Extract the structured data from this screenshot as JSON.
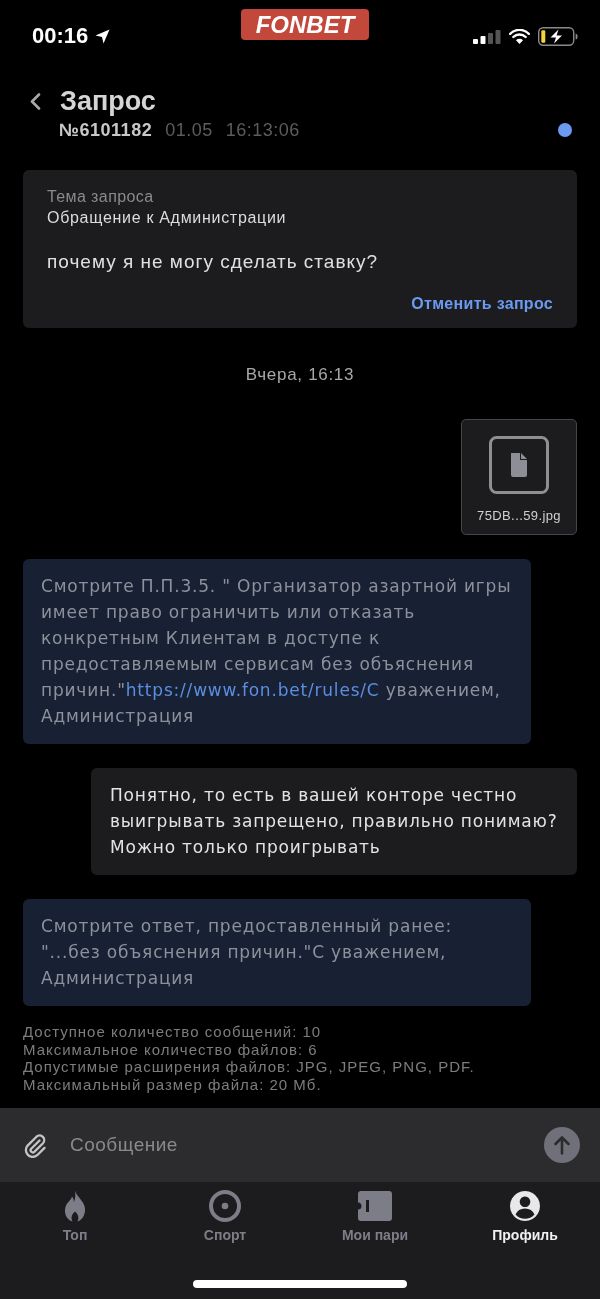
{
  "status_bar": {
    "time": "00:16",
    "logo": "FONBET"
  },
  "header": {
    "title": "Запрос",
    "request_number": "№6101182",
    "date": "01.05",
    "time": "16:13:06"
  },
  "request": {
    "topic_label": "Тема запроса",
    "topic": "Обращение к Администрации",
    "question": "почему я не могу сделать ставку?",
    "cancel_action": "Отменить запрос"
  },
  "messages": [
    {
      "kind": "date",
      "text": "Вчера, 16:13"
    },
    {
      "kind": "file",
      "outgoing": true,
      "file_name": "75DB...59.jpg"
    },
    {
      "kind": "text",
      "outgoing": false,
      "text": "Смотрите П.П.3.5. \" Организатор азартной игры имеет право ограничить или отказать конкретным Клиентам в доступе к предоставляемым сервисам без объяснения причин.\"",
      "link": "https://www.fon.bet/rules/С",
      "text_after": "уважением, Администрация"
    },
    {
      "kind": "text",
      "outgoing": true,
      "text": "Понятно, то есть в вашей конторе честно выигрывать запрещено, правильно понимаю? Можно только проигрывать"
    },
    {
      "kind": "text",
      "outgoing": false,
      "text": "Смотрите ответ, предоставленный ранее: \"...без объяснения причин.\"С уважением, Администрация"
    }
  ],
  "limits": [
    "Доступное количество сообщений: 10",
    "Максимальное количество файлов: 6",
    "Допустимые расширения файлов: JPG, JPEG, PNG, PDF.",
    "Максимальный размер файла: 20 Мб."
  ],
  "composer": {
    "placeholder": "Сообщение"
  },
  "tabs": [
    {
      "label": "Топ",
      "selected": false
    },
    {
      "label": "Спорт",
      "selected": false
    },
    {
      "label": "Мои пари",
      "selected": false
    },
    {
      "label": "Профиль",
      "selected": true
    }
  ]
}
